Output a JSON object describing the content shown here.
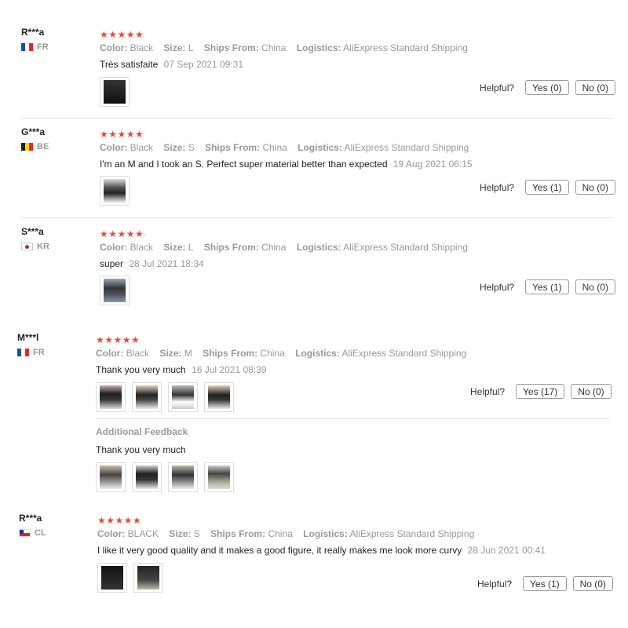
{
  "labels": {
    "color": "Color:",
    "size": "Size:",
    "ships_from": "Ships From:",
    "logistics": "Logistics:",
    "helpful": "Helpful?",
    "additional_feedback": "Additional Feedback"
  },
  "reviews": [
    {
      "name": "R***a",
      "country": "FR",
      "flag": "fr",
      "rating": 5,
      "color": "Black",
      "size": "L",
      "ships_from": "China",
      "logistics": "AliExpress Standard Shipping",
      "text": "Très satisfaite",
      "date": "07 Sep 2021 09:31",
      "yes": "Yes (0)",
      "no": "No (0)",
      "photos": [
        "black-corset-photo"
      ]
    },
    {
      "name": "G***a",
      "country": "BE",
      "flag": "be",
      "rating": 5,
      "color": "Black",
      "size": "S",
      "ships_from": "China",
      "logistics": "AliExpress Standard Shipping",
      "text": "I'm an M and I took an S. Perfect super material better than expected",
      "date": "19 Aug 2021 06:15",
      "yes": "Yes (1)",
      "no": "No (0)",
      "photos": [
        "waist-photo"
      ]
    },
    {
      "name": "S***a",
      "country": "KR",
      "flag": "kr",
      "rating": 5,
      "color": "Black",
      "size": "L",
      "ships_from": "China",
      "logistics": "AliExpress Standard Shipping",
      "text": "super",
      "date": "28 Jul 2021 18:34",
      "yes": "Yes (1)",
      "no": "No (0)",
      "photos": [
        "mirror-photo"
      ]
    },
    {
      "name": "M***l",
      "country": "FR",
      "flag": "fr",
      "rating": 5,
      "color": "Black",
      "size": "M",
      "ships_from": "China",
      "logistics": "AliExpress Standard Shipping",
      "text": "Thank you very much",
      "date": "16 Jul 2021 08:39",
      "yes": "Yes (17)",
      "no": "No (0)",
      "photos": [
        "waist-front-photo",
        "waist-side-photo",
        "waist-mirror-photo",
        "waist-back-photo"
      ],
      "additional_text": "Thank you very much",
      "additional_photos": [
        "side-photo",
        "front-photo",
        "front-photo-2",
        "mirror-photo-2"
      ]
    },
    {
      "name": "R***a",
      "country": "CL",
      "flag": "cl",
      "rating": 5,
      "color": "BLACK",
      "size": "S",
      "ships_from": "China",
      "logistics": "AliExpress Standard Shipping",
      "text": "I like it very good quality and it makes a good figure, it really makes me look more curvy",
      "date": "28 Jun 2021 00:41",
      "yes": "Yes (1)",
      "no": "No (0)",
      "photos": [
        "black-corset-flat-photo",
        "corset-photo"
      ]
    }
  ],
  "stars": {
    "full": "★★★★★",
    "partial": "★★★★★",
    "partial_dot": "·"
  }
}
